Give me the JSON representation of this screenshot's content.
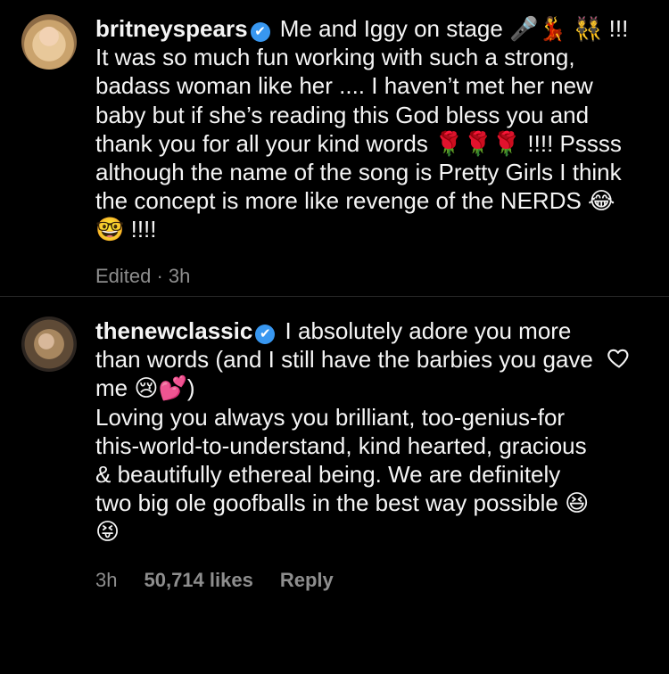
{
  "comments": [
    {
      "username": "britneyspears",
      "verified_icon": "✔",
      "text": "Me and Iggy on stage 🎤💃 👯 !!! It was so much fun working with such a strong, badass woman like her .... I haven’t met her new baby but if she’s reading this God bless you and thank you for all your kind words 🌹🌹🌹 !!!! Pssss although the name of the song is Pretty Girls I think the concept is more like revenge of the NERDS 😂🤓 !!!!",
      "meta": {
        "edited": "Edited · 3h"
      }
    },
    {
      "username": "thenewclassic",
      "verified_icon": "✔",
      "text_line1": "I absolutely adore you more than words (and I still have the barbies you gave me 😢💕)",
      "text_line2": "Loving you always you brilliant, too-genius-for this-world-to-understand, kind hearted,  gracious & beautifully ethereal being. We are definitely two big ole goofballs in the best way possible 😆 😝",
      "meta": {
        "time": "3h",
        "likes": "50,714 likes",
        "reply": "Reply"
      }
    }
  ],
  "icons": {
    "like": "heart-outline-icon"
  },
  "colors": {
    "background": "#000000",
    "text": "#f5f5f5",
    "muted": "#8e8e8e",
    "verified": "#3897f0",
    "divider": "#262626"
  }
}
